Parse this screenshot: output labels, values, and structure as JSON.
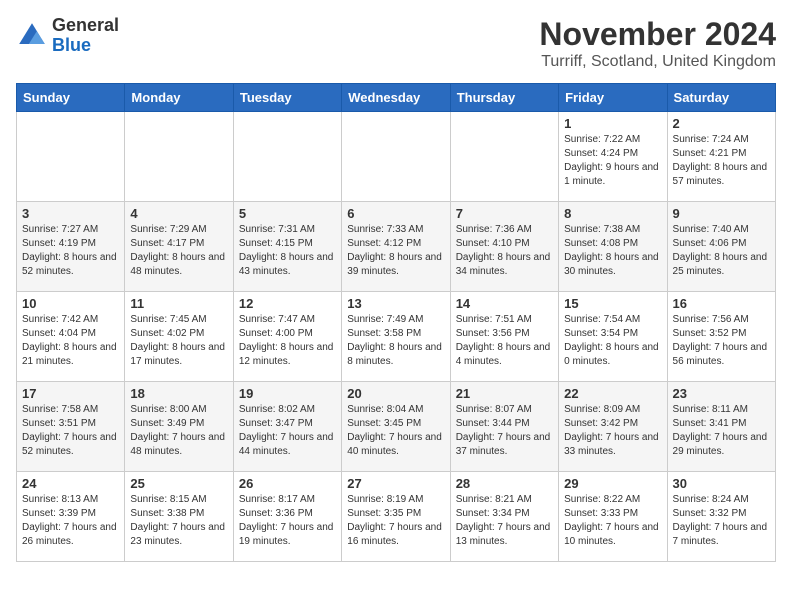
{
  "header": {
    "logo_line1": "General",
    "logo_line2": "Blue",
    "month": "November 2024",
    "location": "Turriff, Scotland, United Kingdom"
  },
  "weekdays": [
    "Sunday",
    "Monday",
    "Tuesday",
    "Wednesday",
    "Thursday",
    "Friday",
    "Saturday"
  ],
  "weeks": [
    [
      {
        "day": "",
        "info": ""
      },
      {
        "day": "",
        "info": ""
      },
      {
        "day": "",
        "info": ""
      },
      {
        "day": "",
        "info": ""
      },
      {
        "day": "",
        "info": ""
      },
      {
        "day": "1",
        "info": "Sunrise: 7:22 AM\nSunset: 4:24 PM\nDaylight: 9 hours and 1 minute."
      },
      {
        "day": "2",
        "info": "Sunrise: 7:24 AM\nSunset: 4:21 PM\nDaylight: 8 hours and 57 minutes."
      }
    ],
    [
      {
        "day": "3",
        "info": "Sunrise: 7:27 AM\nSunset: 4:19 PM\nDaylight: 8 hours and 52 minutes."
      },
      {
        "day": "4",
        "info": "Sunrise: 7:29 AM\nSunset: 4:17 PM\nDaylight: 8 hours and 48 minutes."
      },
      {
        "day": "5",
        "info": "Sunrise: 7:31 AM\nSunset: 4:15 PM\nDaylight: 8 hours and 43 minutes."
      },
      {
        "day": "6",
        "info": "Sunrise: 7:33 AM\nSunset: 4:12 PM\nDaylight: 8 hours and 39 minutes."
      },
      {
        "day": "7",
        "info": "Sunrise: 7:36 AM\nSunset: 4:10 PM\nDaylight: 8 hours and 34 minutes."
      },
      {
        "day": "8",
        "info": "Sunrise: 7:38 AM\nSunset: 4:08 PM\nDaylight: 8 hours and 30 minutes."
      },
      {
        "day": "9",
        "info": "Sunrise: 7:40 AM\nSunset: 4:06 PM\nDaylight: 8 hours and 25 minutes."
      }
    ],
    [
      {
        "day": "10",
        "info": "Sunrise: 7:42 AM\nSunset: 4:04 PM\nDaylight: 8 hours and 21 minutes."
      },
      {
        "day": "11",
        "info": "Sunrise: 7:45 AM\nSunset: 4:02 PM\nDaylight: 8 hours and 17 minutes."
      },
      {
        "day": "12",
        "info": "Sunrise: 7:47 AM\nSunset: 4:00 PM\nDaylight: 8 hours and 12 minutes."
      },
      {
        "day": "13",
        "info": "Sunrise: 7:49 AM\nSunset: 3:58 PM\nDaylight: 8 hours and 8 minutes."
      },
      {
        "day": "14",
        "info": "Sunrise: 7:51 AM\nSunset: 3:56 PM\nDaylight: 8 hours and 4 minutes."
      },
      {
        "day": "15",
        "info": "Sunrise: 7:54 AM\nSunset: 3:54 PM\nDaylight: 8 hours and 0 minutes."
      },
      {
        "day": "16",
        "info": "Sunrise: 7:56 AM\nSunset: 3:52 PM\nDaylight: 7 hours and 56 minutes."
      }
    ],
    [
      {
        "day": "17",
        "info": "Sunrise: 7:58 AM\nSunset: 3:51 PM\nDaylight: 7 hours and 52 minutes."
      },
      {
        "day": "18",
        "info": "Sunrise: 8:00 AM\nSunset: 3:49 PM\nDaylight: 7 hours and 48 minutes."
      },
      {
        "day": "19",
        "info": "Sunrise: 8:02 AM\nSunset: 3:47 PM\nDaylight: 7 hours and 44 minutes."
      },
      {
        "day": "20",
        "info": "Sunrise: 8:04 AM\nSunset: 3:45 PM\nDaylight: 7 hours and 40 minutes."
      },
      {
        "day": "21",
        "info": "Sunrise: 8:07 AM\nSunset: 3:44 PM\nDaylight: 7 hours and 37 minutes."
      },
      {
        "day": "22",
        "info": "Sunrise: 8:09 AM\nSunset: 3:42 PM\nDaylight: 7 hours and 33 minutes."
      },
      {
        "day": "23",
        "info": "Sunrise: 8:11 AM\nSunset: 3:41 PM\nDaylight: 7 hours and 29 minutes."
      }
    ],
    [
      {
        "day": "24",
        "info": "Sunrise: 8:13 AM\nSunset: 3:39 PM\nDaylight: 7 hours and 26 minutes."
      },
      {
        "day": "25",
        "info": "Sunrise: 8:15 AM\nSunset: 3:38 PM\nDaylight: 7 hours and 23 minutes."
      },
      {
        "day": "26",
        "info": "Sunrise: 8:17 AM\nSunset: 3:36 PM\nDaylight: 7 hours and 19 minutes."
      },
      {
        "day": "27",
        "info": "Sunrise: 8:19 AM\nSunset: 3:35 PM\nDaylight: 7 hours and 16 minutes."
      },
      {
        "day": "28",
        "info": "Sunrise: 8:21 AM\nSunset: 3:34 PM\nDaylight: 7 hours and 13 minutes."
      },
      {
        "day": "29",
        "info": "Sunrise: 8:22 AM\nSunset: 3:33 PM\nDaylight: 7 hours and 10 minutes."
      },
      {
        "day": "30",
        "info": "Sunrise: 8:24 AM\nSunset: 3:32 PM\nDaylight: 7 hours and 7 minutes."
      }
    ]
  ]
}
